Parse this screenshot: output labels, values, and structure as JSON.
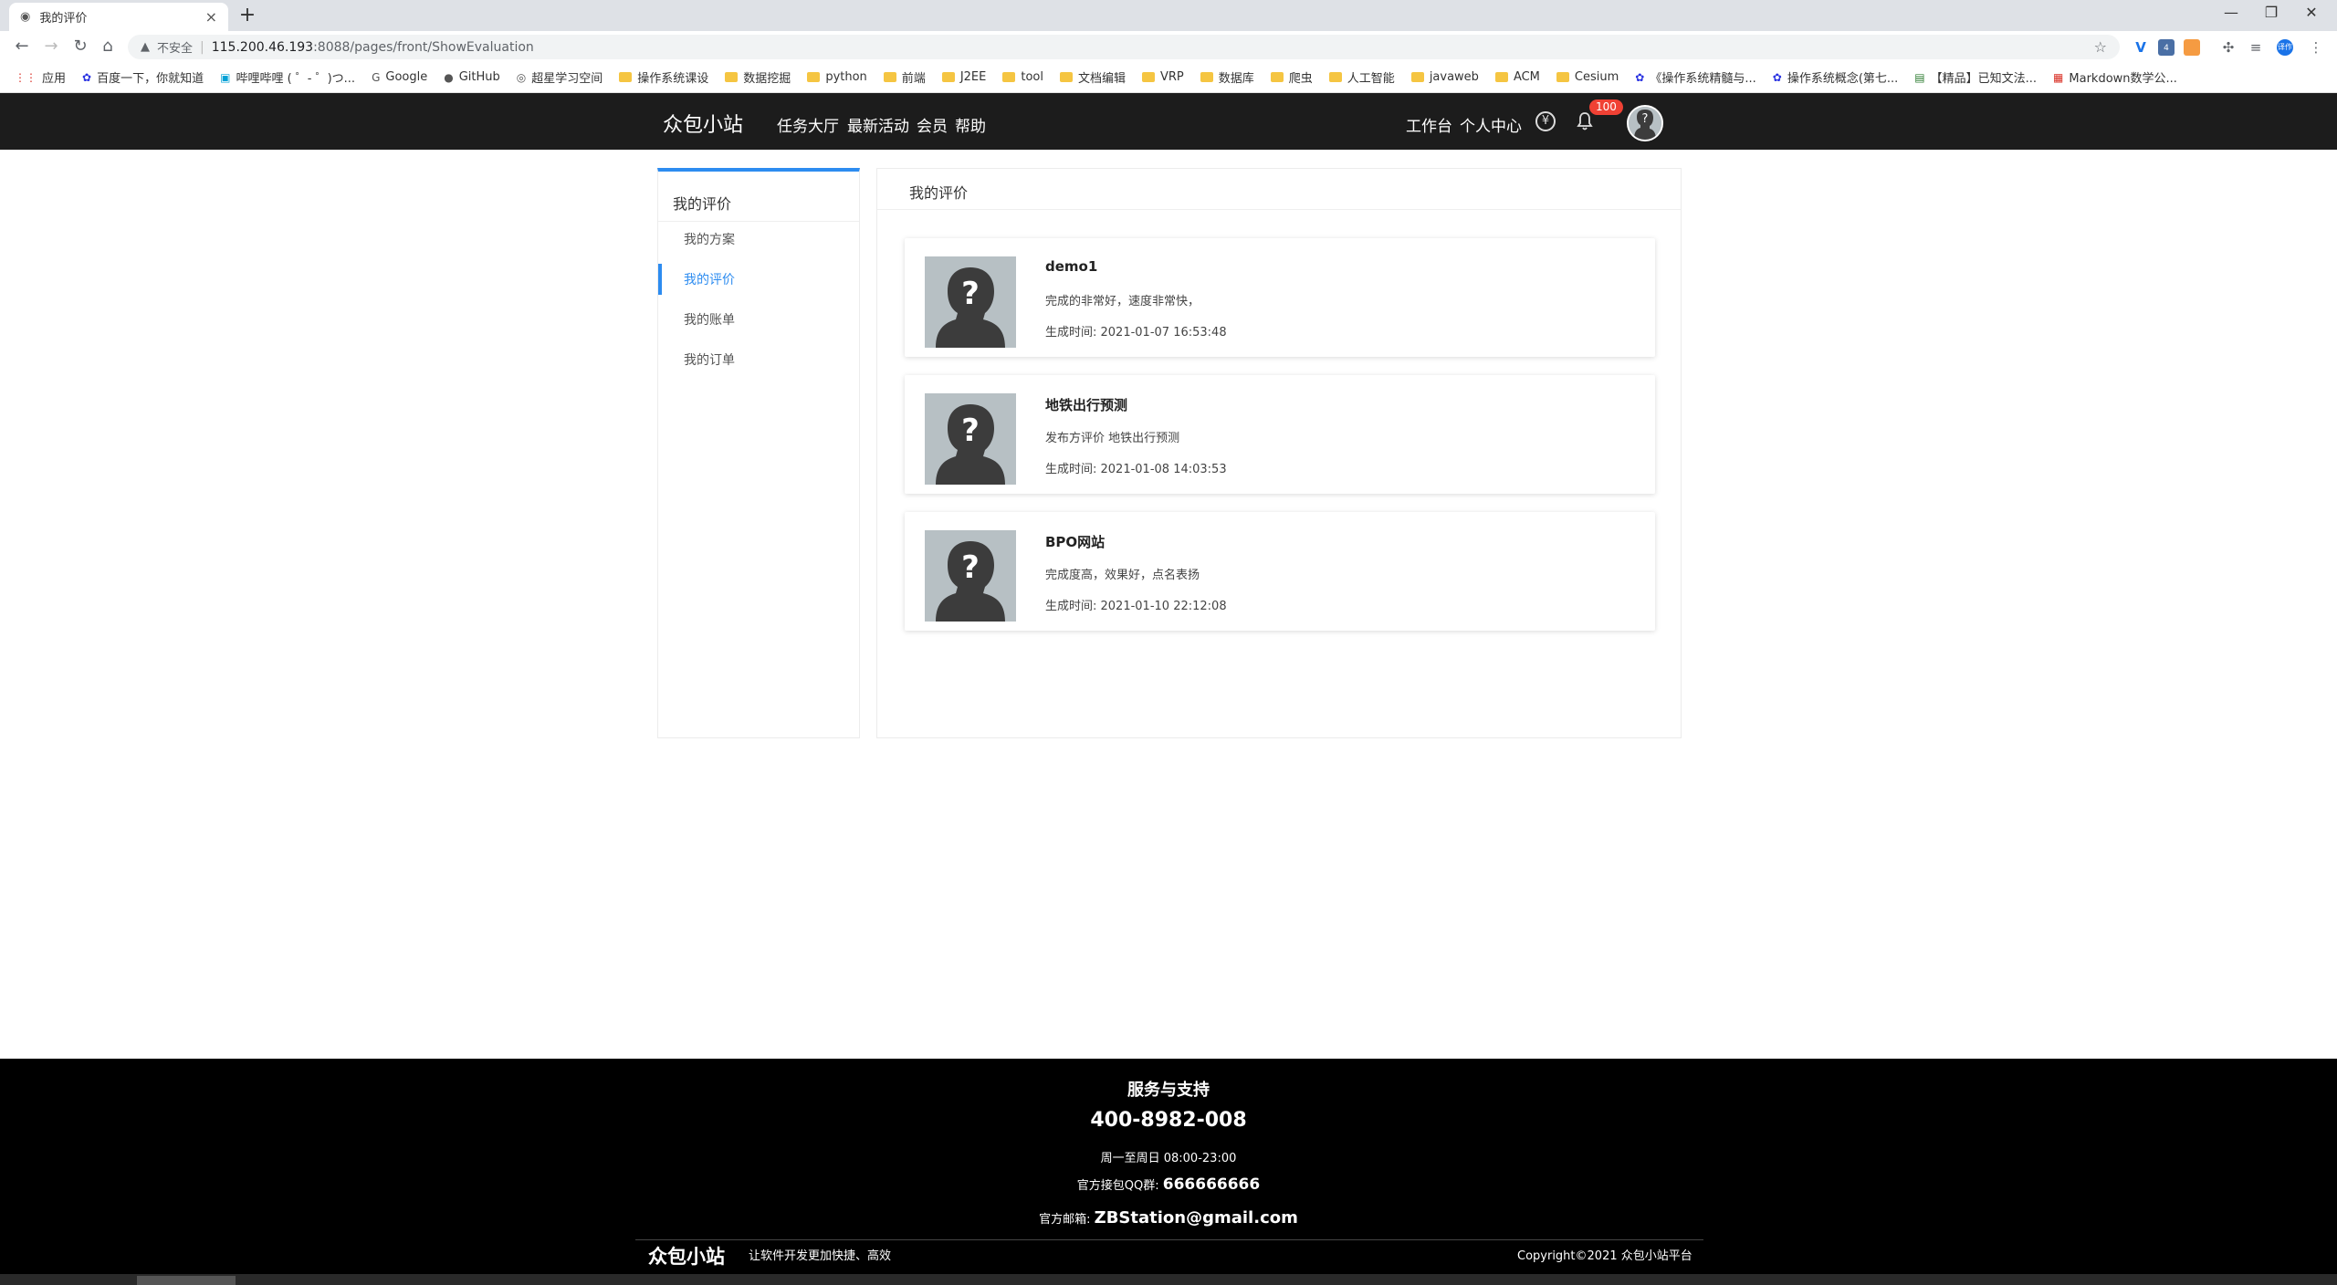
{
  "browser": {
    "tab_title": "我的评价",
    "tab_close": "×",
    "new_tab": "+",
    "insecure_label": "不安全",
    "url_host": "115.200.46.193",
    "url_rest": ":8088/pages/front/ShowEvaluation",
    "window_controls": [
      "—",
      "❐",
      "✕"
    ],
    "extension_badge": "4",
    "profile_label": "译作"
  },
  "bookmarks": [
    {
      "label": "应用",
      "icon": "apps-icon"
    },
    {
      "label": "百度一下，你就知道",
      "icon": "baidu-icon"
    },
    {
      "label": "哔哩哔哩 ( ゜- ゜)つ...",
      "icon": "bilibili-icon"
    },
    {
      "label": "Google",
      "icon": "google-icon"
    },
    {
      "label": "GitHub",
      "icon": "github-icon"
    },
    {
      "label": "超星学习空间",
      "icon": "globe-icon"
    },
    {
      "label": "操作系统课设",
      "icon": "folder-icon"
    },
    {
      "label": "数据挖掘",
      "icon": "folder-icon"
    },
    {
      "label": "python",
      "icon": "folder-icon"
    },
    {
      "label": "前端",
      "icon": "folder-icon"
    },
    {
      "label": "J2EE",
      "icon": "folder-icon"
    },
    {
      "label": "tool",
      "icon": "folder-icon"
    },
    {
      "label": "文档编辑",
      "icon": "folder-icon"
    },
    {
      "label": "VRP",
      "icon": "folder-icon"
    },
    {
      "label": "数据库",
      "icon": "folder-icon"
    },
    {
      "label": "爬虫",
      "icon": "folder-icon"
    },
    {
      "label": "人工智能",
      "icon": "folder-icon"
    },
    {
      "label": "javaweb",
      "icon": "folder-icon"
    },
    {
      "label": "ACM",
      "icon": "folder-icon"
    },
    {
      "label": "Cesium",
      "icon": "folder-icon"
    },
    {
      "label": "《操作系统精髓与...",
      "icon": "baidu-icon"
    },
    {
      "label": "操作系统概念(第七...",
      "icon": "baidu-icon"
    },
    {
      "label": "【精品】已知文法...",
      "icon": "doc-icon"
    },
    {
      "label": "Markdown数学公...",
      "icon": "pdf-icon"
    }
  ],
  "header": {
    "brand": "众包小站",
    "nav": [
      "任务大厅",
      "最新活动",
      "会员",
      "帮助"
    ],
    "workbench": "工作台",
    "personal_center": "个人中心",
    "yen_symbol": "¥",
    "notification_count": "100"
  },
  "sidebar": {
    "title": "我的评价",
    "items": [
      {
        "label": "我的方案",
        "active": false
      },
      {
        "label": "我的评价",
        "active": true
      },
      {
        "label": "我的账单",
        "active": false
      },
      {
        "label": "我的订单",
        "active": false
      }
    ]
  },
  "main": {
    "title": "我的评价",
    "evaluations": [
      {
        "title": "demo1",
        "content": "完成的非常好，速度非常快，",
        "time_label": "生成时间: ",
        "time": "2021-01-07 16:53:48"
      },
      {
        "title": "地铁出行预测",
        "content": "发布方评价 地铁出行预测",
        "time_label": "生成时间: ",
        "time": "2021-01-08 14:03:53"
      },
      {
        "title": "BPO网站",
        "content": "完成度高，效果好，点名表扬",
        "time_label": "生成时间: ",
        "time": "2021-01-10 22:12:08"
      }
    ]
  },
  "footer": {
    "title": "服务与支持",
    "phone": "400-8982-008",
    "hours": "周一至周日 08:00-23:00",
    "qq_label": "官方接包QQ群: ",
    "qq": "666666666",
    "mail_label": "官方邮箱: ",
    "mail": "ZBStation@gmail.com",
    "brand": "众包小站",
    "slogan": "让软件开发更加快捷、高效",
    "copyright": "Copyright©2021 众包小站平台"
  },
  "colors": {
    "accent": "#2d8cf0",
    "header_bg": "#1c1c1c",
    "footer_bg": "#000000",
    "badge": "#f04134"
  }
}
